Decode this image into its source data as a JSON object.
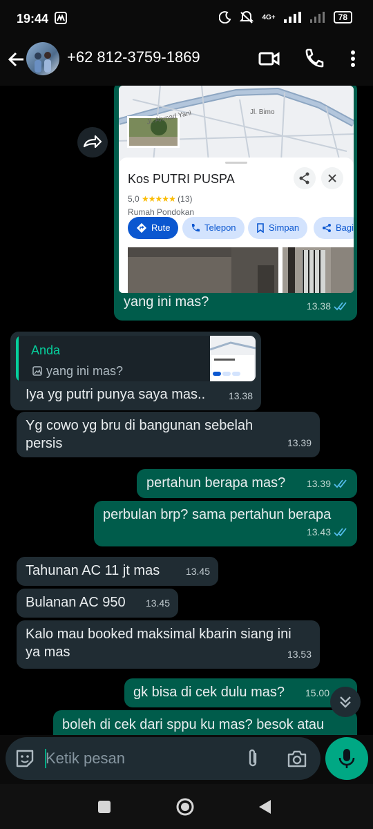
{
  "status_bar": {
    "time": "19:44",
    "network": "4G+",
    "battery": "78"
  },
  "header": {
    "contact": "+62 812-3759-1869"
  },
  "map_card": {
    "streets": [
      "Jl. Ahmad Yani",
      "Jl. Bimo"
    ],
    "place_name": "Kos PUTRI PUSPA",
    "rating": "5,0",
    "stars": "★★★★★",
    "reviews": "(13)",
    "place_type": "Rumah Pondokan",
    "actions": [
      "Rute",
      "Telepon",
      "Simpan",
      "Bagi"
    ],
    "caption": "yang ini mas?",
    "time": "13.38"
  },
  "messages": [
    {
      "id": "m1",
      "dir": "in",
      "text": "Iya yg putri punya saya mas..",
      "time": "13.38",
      "quote": {
        "author": "Anda",
        "text": "yang ini mas?"
      }
    },
    {
      "id": "m2",
      "dir": "in",
      "text": "Yg cowo yg bru di bangunan sebelah persis",
      "time": "13.39"
    },
    {
      "id": "m3",
      "dir": "out",
      "text": "pertahun berapa mas?",
      "time": "13.39"
    },
    {
      "id": "m4",
      "dir": "out",
      "text": "perbulan brp? sama pertahun berapa",
      "time": "13.43"
    },
    {
      "id": "m5",
      "dir": "in",
      "text": "Tahunan AC 11 jt mas",
      "time": "13.45"
    },
    {
      "id": "m6",
      "dir": "in",
      "text": "Bulanan AC 950",
      "time": "13.45"
    },
    {
      "id": "m7",
      "dir": "in",
      "text": "Kalo mau booked maksimal kbarin siang ini ya mas",
      "time": "13.53"
    },
    {
      "id": "m8",
      "dir": "out",
      "text": "gk bisa di cek dulu mas?",
      "time": "15.00"
    },
    {
      "id": "m9",
      "dir": "out",
      "text": "boleh di cek dari sppu ku mas? besok atau",
      "time": ""
    }
  ],
  "composer": {
    "placeholder": "Ketik pesan"
  },
  "colors": {
    "incoming": "#202c33",
    "outgoing": "#005c4b",
    "accent": "#00a884",
    "read_ticks": "#53bdeb"
  }
}
